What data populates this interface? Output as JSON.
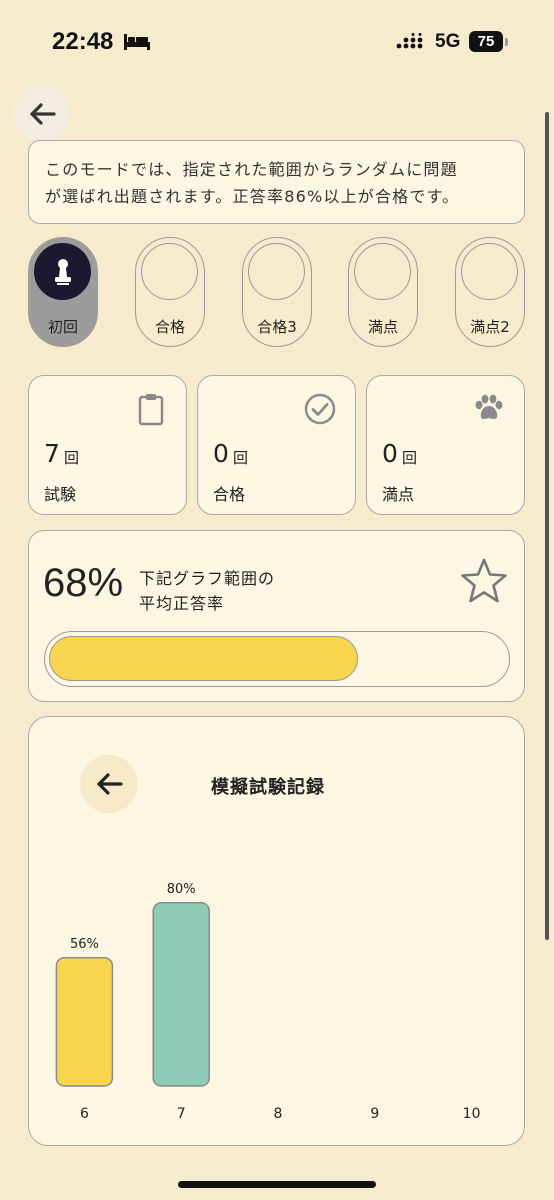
{
  "status_bar": {
    "time": "22:48",
    "network": "5G",
    "battery": "75"
  },
  "description": {
    "line1": "このモードでは、指定された範囲からランダムに問題",
    "line2": "が選ばれ出題されます。正答率86%以上が合格です。"
  },
  "badges": [
    {
      "label": "初回",
      "active": true
    },
    {
      "label": "合格",
      "active": false
    },
    {
      "label": "合格3",
      "active": false
    },
    {
      "label": "満点",
      "active": false
    },
    {
      "label": "満点2",
      "active": false
    }
  ],
  "stats": [
    {
      "value": "7",
      "unit": "回",
      "label": "試験",
      "icon": "clipboard-icon"
    },
    {
      "value": "0",
      "unit": "回",
      "label": "合格",
      "icon": "check-circle-icon"
    },
    {
      "value": "0",
      "unit": "回",
      "label": "満点",
      "icon": "paw-icon"
    }
  ],
  "average": {
    "percent_text": "68%",
    "caption_line1": "下記グラフ範囲の",
    "caption_line2": "平均正答率",
    "progress": 0.68
  },
  "chart_title": "模擬試験記録",
  "chart_data": {
    "type": "bar",
    "categories": [
      "6",
      "7",
      "8",
      "9",
      "10"
    ],
    "values": [
      56,
      80,
      null,
      null,
      null
    ],
    "value_labels": [
      "56%",
      "80%",
      "",
      "",
      ""
    ],
    "colors": [
      "#f7d54f",
      "#8ecbb5"
    ],
    "ylim": [
      0,
      100
    ]
  }
}
